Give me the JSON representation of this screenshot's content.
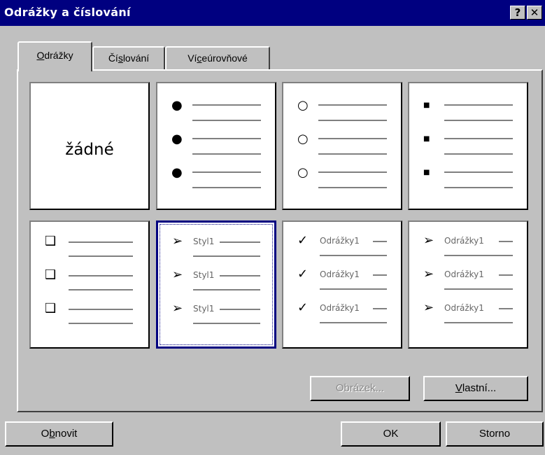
{
  "window": {
    "title": "Odrážky a číslování",
    "help_label": "?",
    "close_label": "✕"
  },
  "tabs": [
    {
      "pre": "",
      "key": "O",
      "post": "drážky",
      "active": true
    },
    {
      "pre": "Čí",
      "key": "s",
      "post": "lování",
      "active": false
    },
    {
      "pre": "Ví",
      "key": "c",
      "post": "eúrovňové",
      "active": false
    }
  ],
  "bullets": {
    "none_label": "žádné",
    "row1": [
      {
        "symbol": "●",
        "icon": "filled-circle-icon"
      },
      {
        "symbol": "○",
        "icon": "hollow-circle-icon"
      },
      {
        "symbol": "■",
        "icon": "filled-square-icon"
      }
    ],
    "row2": [
      {
        "symbol": "❑",
        "icon": "shadowed-box-icon",
        "text": ""
      },
      {
        "symbol": "➢",
        "icon": "arrowhead-icon",
        "text": "Styl1",
        "selected": true
      },
      {
        "symbol": "✓",
        "icon": "checkmark-icon",
        "text": "Odrážky1"
      },
      {
        "symbol": "➢",
        "icon": "arrowhead-icon",
        "text": "Odrážky1"
      }
    ]
  },
  "buttons": {
    "picture_label": "Obrázek...",
    "custom_key": "V",
    "custom_rest": "lastní...",
    "reset_pre": "O",
    "reset_key": "b",
    "reset_post": "novit",
    "ok_label": "OK",
    "cancel_label": "Storno"
  }
}
